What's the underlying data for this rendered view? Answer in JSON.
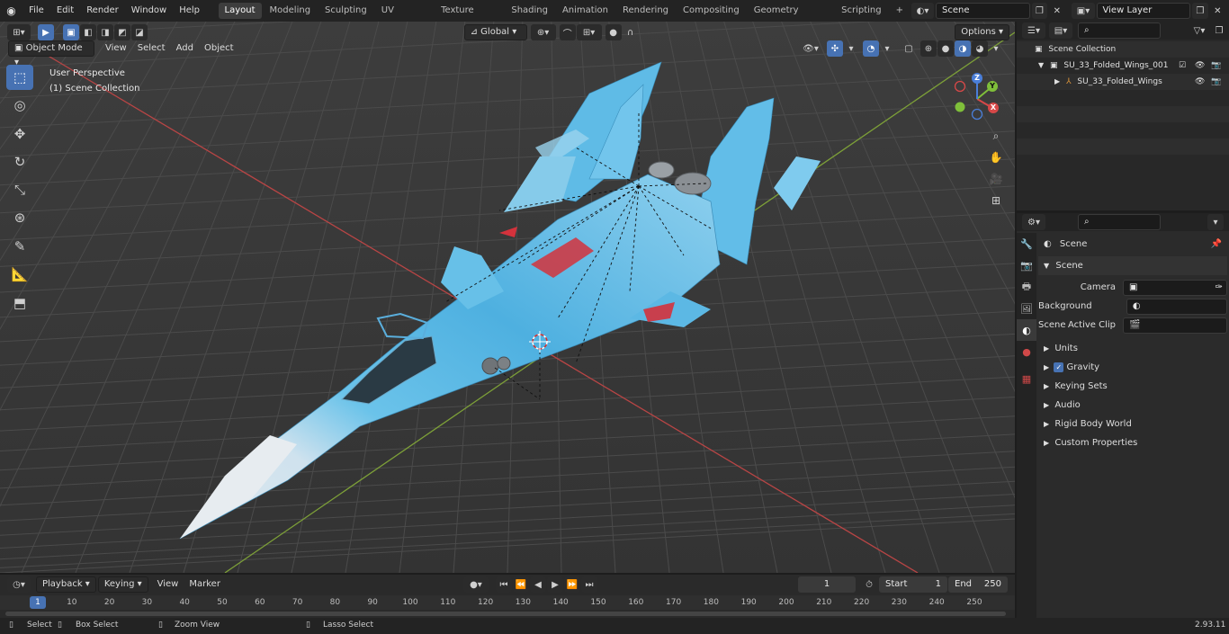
{
  "topbar": {
    "menus": [
      "File",
      "Edit",
      "Render",
      "Window",
      "Help"
    ],
    "workspaces": [
      "Layout",
      "Modeling",
      "Sculpting",
      "UV Editing",
      "Texture Paint",
      "Shading",
      "Animation",
      "Rendering",
      "Compositing",
      "Geometry Nodes",
      "Scripting"
    ],
    "active_workspace": "Layout",
    "add_tab": "+",
    "scene_name": "Scene",
    "view_layer": "View Layer"
  },
  "viewport": {
    "mode": "Object Mode",
    "menus": [
      "View",
      "Select",
      "Add",
      "Object"
    ],
    "transform_orientation": "Global",
    "options_label": "Options",
    "perspective": "User Perspective",
    "collection": "(1) Scene Collection",
    "gizmo": {
      "x": "X",
      "y": "Y",
      "z": "Z"
    }
  },
  "outliner": {
    "root": "Scene Collection",
    "items": [
      {
        "label": "SU_33_Folded_Wings_001",
        "level": 1
      },
      {
        "label": "SU_33_Folded_Wings",
        "level": 2
      }
    ]
  },
  "properties": {
    "context": "Scene",
    "section": "Scene",
    "fields": [
      {
        "label": "Camera",
        "value": ""
      },
      {
        "label": "Background Scene",
        "value": ""
      },
      {
        "label": "Active Clip",
        "value": ""
      }
    ],
    "panels": [
      "Units",
      "Gravity",
      "Keying Sets",
      "Audio",
      "Rigid Body World",
      "Custom Properties"
    ],
    "gravity_checked": true
  },
  "timeline": {
    "menus": [
      "Playback",
      "Keying",
      "View",
      "Marker"
    ],
    "current_frame": "1",
    "start_label": "Start",
    "start": "1",
    "end_label": "End",
    "end": "250",
    "ruler": [
      "1",
      "10",
      "20",
      "30",
      "40",
      "50",
      "60",
      "70",
      "80",
      "90",
      "100",
      "110",
      "120",
      "130",
      "140",
      "150",
      "160",
      "170",
      "180",
      "190",
      "200",
      "210",
      "220",
      "230",
      "240",
      "250"
    ]
  },
  "statusbar": {
    "hints": [
      "Select",
      "Box Select",
      "Zoom View",
      "Lasso Select"
    ],
    "version": "2.93.11"
  },
  "colors": {
    "accent": "#4772b3",
    "axis_x": "#c84848",
    "axis_y": "#7fa035",
    "grid": "#4a4a4a",
    "aircraft_blue": "#5ab8e6"
  }
}
